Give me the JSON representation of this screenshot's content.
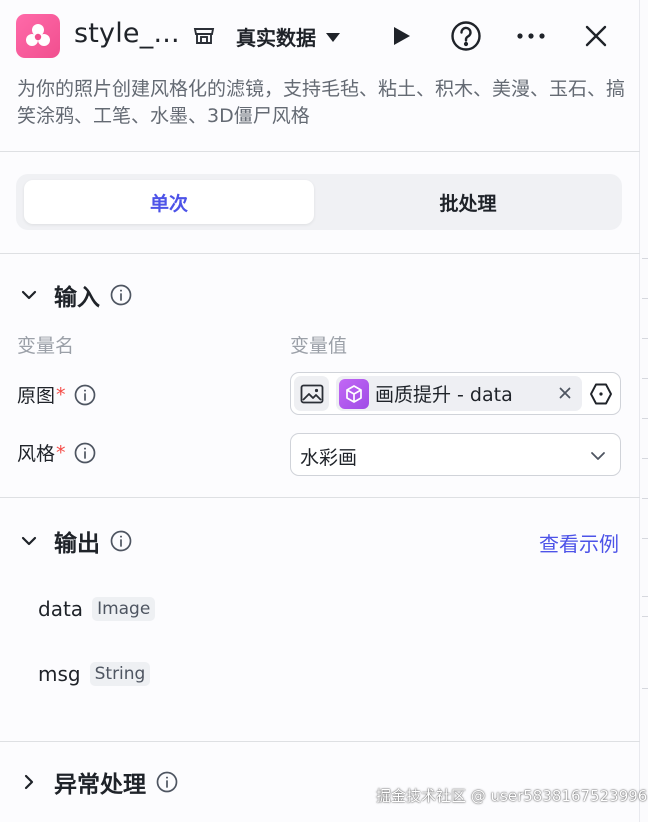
{
  "header": {
    "title": "style_...",
    "app_icon": "flower-icon",
    "store_icon": "store-icon",
    "mode_label": "真实数据",
    "run_icon": "play-icon",
    "help_icon": "question-circle-icon",
    "more_icon": "more-horizontal-icon",
    "close_icon": "close-icon",
    "description": "为你的照片创建风格化的滤镜，支持毛毡、粘土、积木、美漫、玉石、搞笑涂鸦、工笔、水墨、3D僵尸风格"
  },
  "tabs": [
    {
      "label": "单次",
      "active": true
    },
    {
      "label": "批处理",
      "active": false
    }
  ],
  "input_section": {
    "title": "输入",
    "col_name": "变量名",
    "col_value": "变量值",
    "rows": [
      {
        "label": "原图",
        "required": "*",
        "value_chip": "画质提升 - data"
      },
      {
        "label": "风格",
        "required": "*",
        "value": "水彩画"
      }
    ]
  },
  "output_section": {
    "title": "输出",
    "example_link": "查看示例",
    "items": [
      {
        "name": "data",
        "type": "Image"
      },
      {
        "name": "msg",
        "type": "String"
      }
    ]
  },
  "error_section": {
    "title": "异常处理"
  },
  "watermark": "掘金技术社区 @ user5838167523996",
  "colors": {
    "accent": "#4d53e8",
    "required": "#f54a45",
    "app_icon": "#f14f8f",
    "chip_icon": "#a855f7"
  }
}
